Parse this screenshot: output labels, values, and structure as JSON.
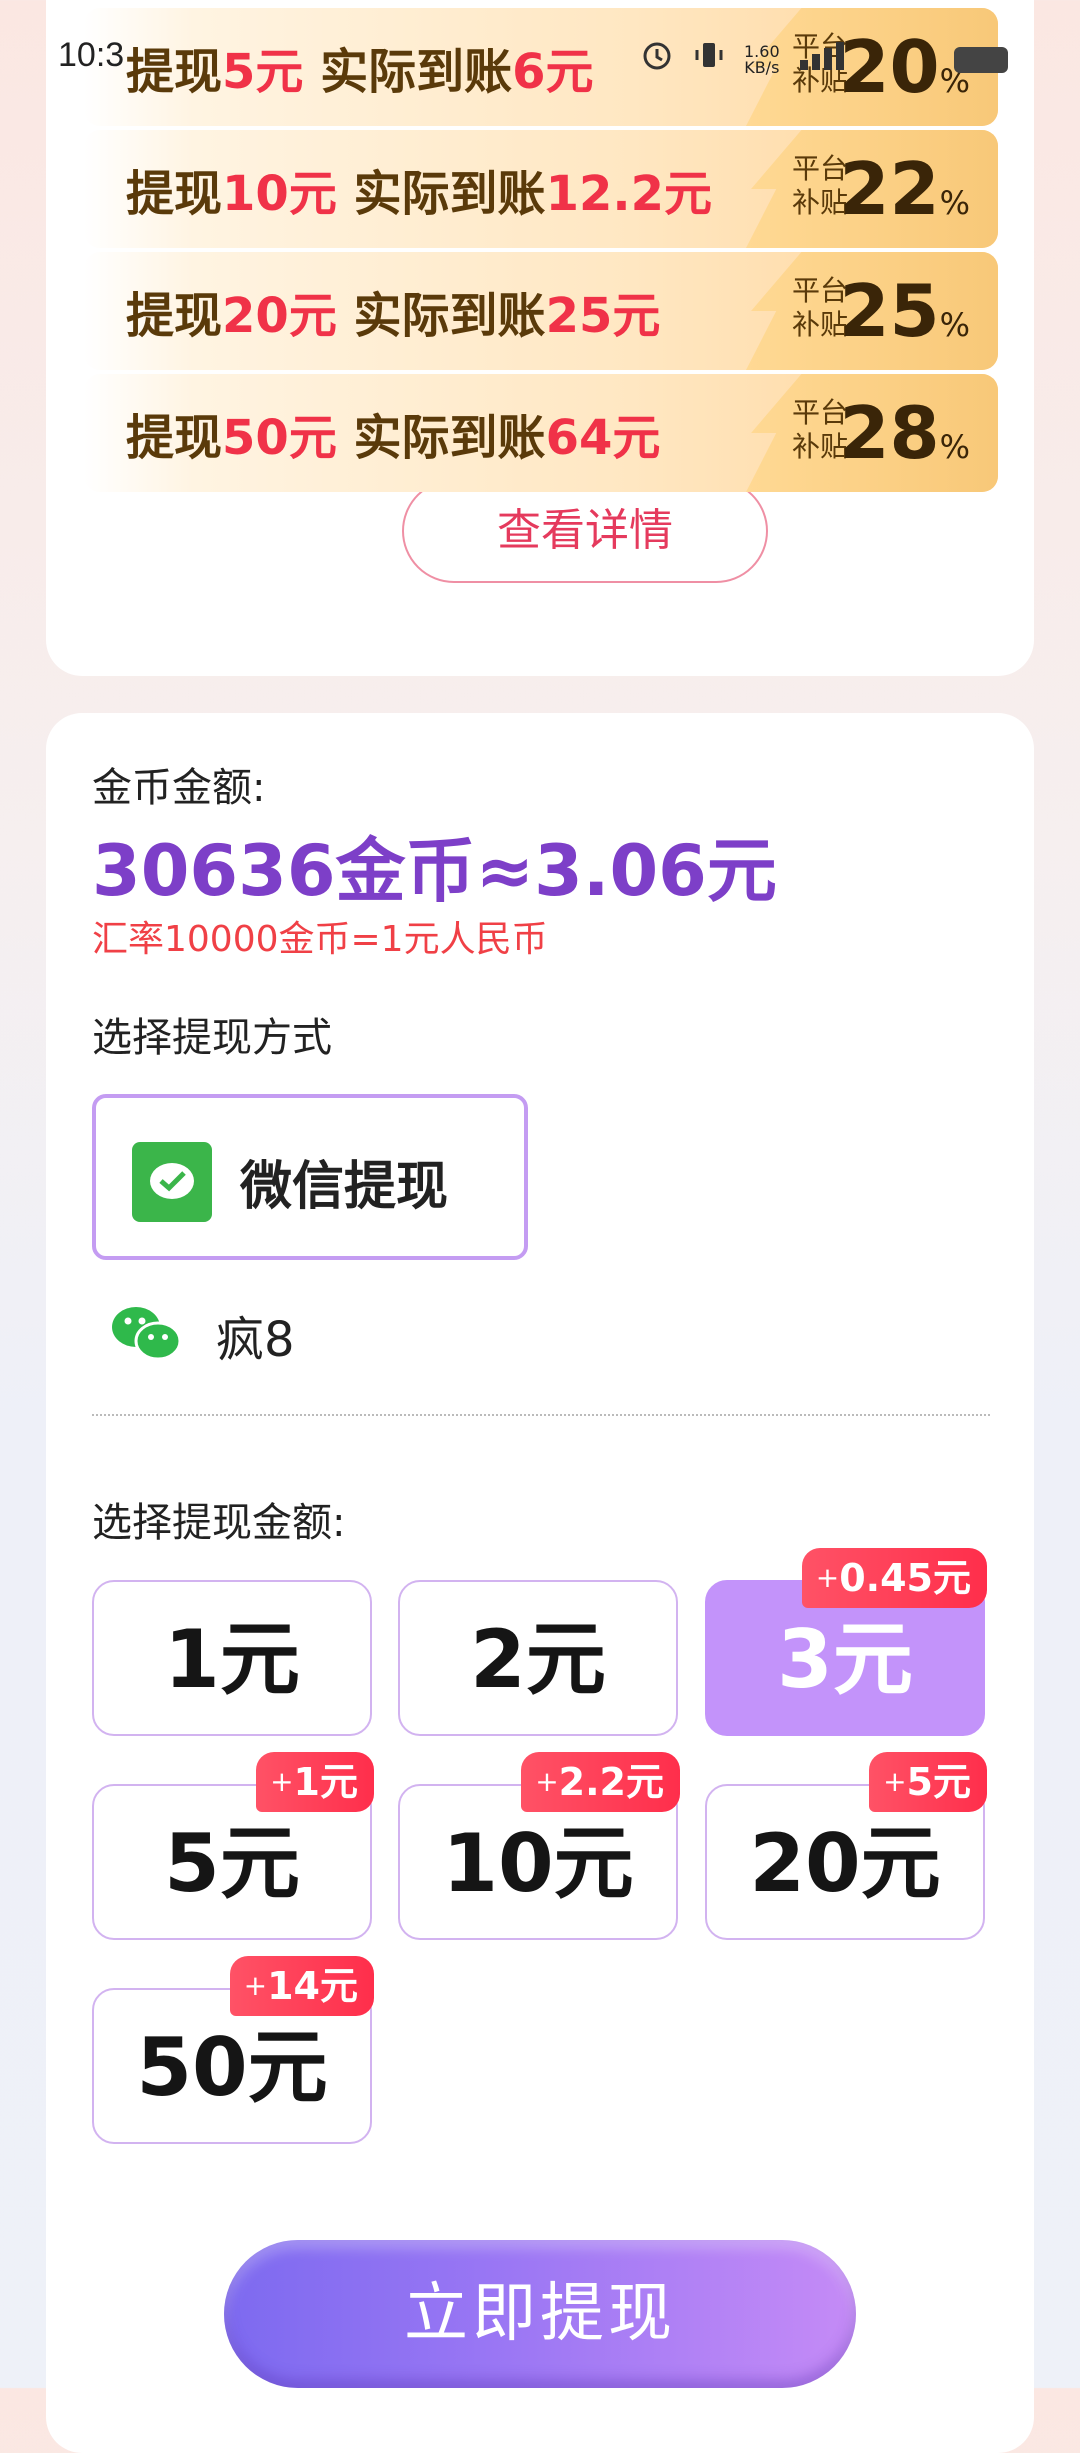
{
  "status_bar": {
    "time": "10:3",
    "net_speed_value": "1.60",
    "net_speed_unit": "KB/s"
  },
  "tiers": [
    {
      "prefix": "提现",
      "amount": "5元",
      "middle": "实际到账",
      "received": "6元",
      "bonus_label_1": "平台",
      "bonus_label_2": "补贴",
      "bonus_pct": "20",
      "pct_sign": "%"
    },
    {
      "prefix": "提现",
      "amount": "10元",
      "middle": "实际到账",
      "received": "12.2元",
      "bonus_label_1": "平台",
      "bonus_label_2": "补贴",
      "bonus_pct": "22",
      "pct_sign": "%"
    },
    {
      "prefix": "提现",
      "amount": "20元",
      "middle": "实际到账",
      "received": "25元",
      "bonus_label_1": "平台",
      "bonus_label_2": "补贴",
      "bonus_pct": "25",
      "pct_sign": "%"
    },
    {
      "prefix": "提现",
      "amount": "50元",
      "middle": "实际到账",
      "received": "64元",
      "bonus_label_1": "平台",
      "bonus_label_2": "补贴",
      "bonus_pct": "28",
      "pct_sign": "%"
    }
  ],
  "details_button": "查看详情",
  "coin_section": {
    "label": "金币金额:",
    "amount": "30636金币≈3.06元",
    "rate": "汇率10000金币=1元人民币"
  },
  "method_section": {
    "label": "选择提现方式",
    "option_label": "微信提现",
    "account_name": "疯8"
  },
  "amount_section": {
    "label": "选择提现金额:",
    "amounts": [
      {
        "label": "1元",
        "bonus": ""
      },
      {
        "label": "2元",
        "bonus": ""
      },
      {
        "label": "3元",
        "bonus": "0.45元"
      },
      {
        "label": "5元",
        "bonus": "1元"
      },
      {
        "label": "10元",
        "bonus": "2.2元"
      },
      {
        "label": "20元",
        "bonus": "5元"
      },
      {
        "label": "50元",
        "bonus": "14元"
      }
    ],
    "bonus_plus": "+",
    "selected_index": 2
  },
  "withdraw_button": "立即提现",
  "colors": {
    "accent_purple": "#7d3fc8",
    "selected_amount": "#c393fa",
    "badge_red": "#ff2e4b",
    "wechat_green": "#3bb54a"
  },
  "icons": [
    "alarm-icon",
    "vibrate-icon",
    "signal-icon",
    "battery-icon",
    "wechat-pay-icon",
    "wechat-logo-icon"
  ]
}
